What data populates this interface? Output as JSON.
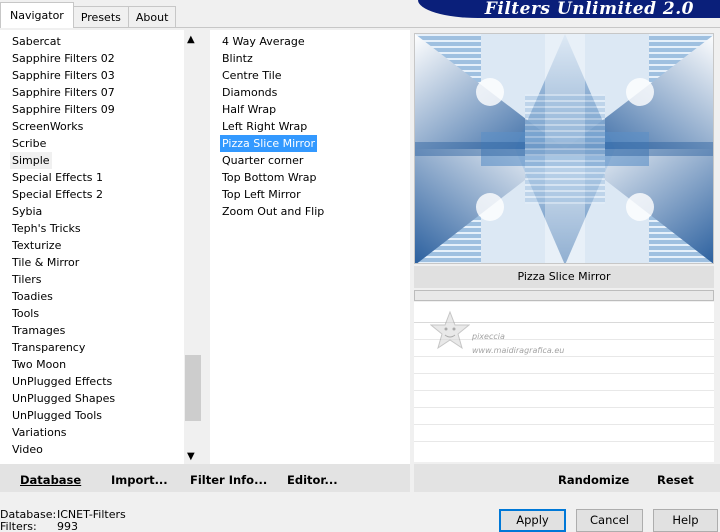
{
  "tabs": [
    {
      "label": "Navigator"
    },
    {
      "label": "Presets"
    },
    {
      "label": "About"
    }
  ],
  "banner": {
    "title": "Filters Unlimited 2.0"
  },
  "categories": [
    "Sabercat",
    "Sapphire Filters 02",
    "Sapphire Filters 03",
    "Sapphire Filters 07",
    "Sapphire Filters 09",
    "ScreenWorks",
    "Scribe",
    "Simple",
    "Special Effects 1",
    "Special Effects 2",
    "Sybia",
    "Teph's Tricks",
    "Texturize",
    "Tile & Mirror",
    "Tilers",
    "Toadies",
    "Tools",
    "Tramages",
    "Transparency",
    "Two Moon",
    "UnPlugged Effects",
    "UnPlugged Shapes",
    "UnPlugged Tools",
    "Variations",
    "Video"
  ],
  "selected_category": "Simple",
  "filters": [
    "4 Way Average",
    "Blintz",
    "Centre Tile",
    "Diamonds",
    "Half Wrap",
    "Left Right Wrap",
    "Pizza Slice Mirror",
    "Quarter corner",
    "Top Bottom Wrap",
    "Top Left Mirror",
    "Zoom Out and Flip"
  ],
  "selected_filter": "Pizza Slice Mirror",
  "preview": {
    "caption": "Pizza Slice Mirror"
  },
  "watermark": {
    "line1": "pixeccia",
    "line2": "www.maidiragrafica.eu"
  },
  "left_buttons": {
    "database": "Database",
    "import": "Import...",
    "filter_info": "Filter Info...",
    "editor": "Editor..."
  },
  "right_buttons": {
    "randomize": "Randomize",
    "reset": "Reset"
  },
  "status": {
    "database_label": "Database:",
    "database_value": "ICNET-Filters",
    "filters_label": "Filters:",
    "filters_value": "993"
  },
  "dialog_buttons": {
    "apply": "Apply",
    "cancel": "Cancel",
    "help": "Help"
  },
  "colors": {
    "selection": "#3399ff",
    "banner": "#0a1f7a",
    "preview_blue": "#2a5f9e"
  }
}
